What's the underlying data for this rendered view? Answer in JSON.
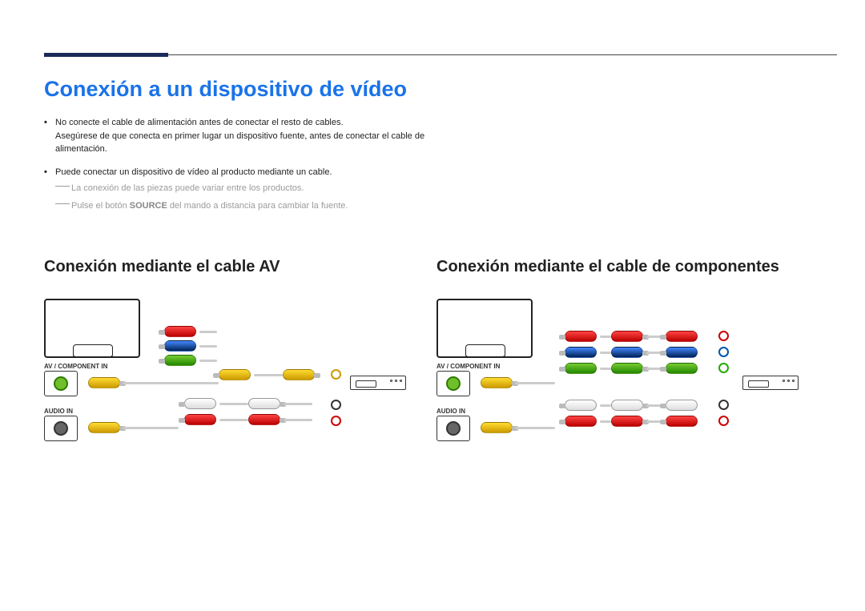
{
  "page_title": "Conexión a un dispositivo de vídeo",
  "bullets": [
    "No conecte el cable de alimentación antes de conectar el resto de cables.\nAsegúrese de que conecta en primer lugar un dispositivo fuente, antes de conectar el cable de alimentación.",
    "Puede conectar un dispositivo de vídeo al producto mediante un cable."
  ],
  "notes": [
    "La conexión de las piezas puede variar entre los productos.",
    "Pulse el botón SOURCE del mando a distancia para cambiar la fuente."
  ],
  "notes_bold": "SOURCE",
  "section_left_title": "Conexión mediante el cable AV",
  "section_right_title": "Conexión mediante el cable de componentes",
  "labels": {
    "av_component": "AV / COMPONENT IN",
    "audio_in": "AUDIO IN"
  }
}
